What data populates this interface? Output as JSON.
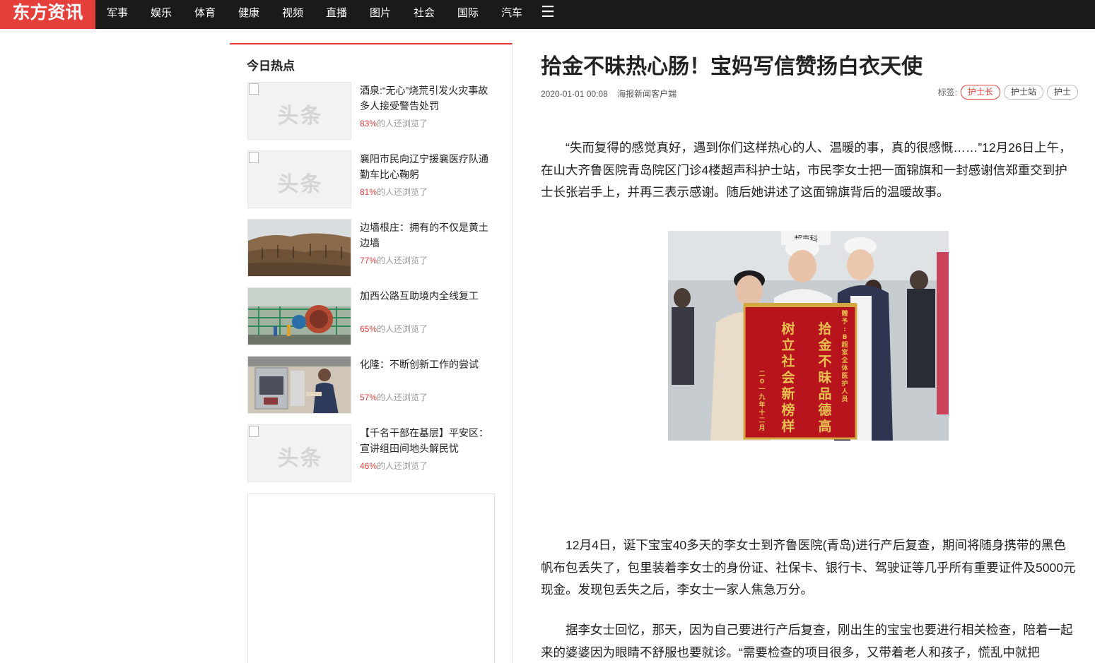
{
  "header": {
    "logo": "东方资讯",
    "nav": [
      "军事",
      "娱乐",
      "体育",
      "健康",
      "视频",
      "直播",
      "图片",
      "社会",
      "国际",
      "汽车"
    ],
    "more_icon": "menu-icon"
  },
  "sidebar": {
    "title": "今日热点",
    "placeholder_text": "头条",
    "stat_suffix": "的人还浏览了",
    "items": [
      {
        "title": "酒泉:“无心”烧荒引发火灾事故 多人接受警告处罚",
        "pct": "83%",
        "thumb": "placeholder"
      },
      {
        "title": "襄阳市民向辽宁援襄医疗队通勤车比心鞠躬",
        "pct": "81%",
        "thumb": "placeholder"
      },
      {
        "title": "边墙根庄：拥有的不仅是黄土边墙",
        "pct": "77%",
        "thumb": "dirt-field"
      },
      {
        "title": "加西公路互助境内全线复工",
        "pct": "65%",
        "thumb": "construction"
      },
      {
        "title": "化隆：不断创新工作的尝试",
        "pct": "57%",
        "thumb": "kitchen"
      },
      {
        "title": "【千名干部在基层】平安区：宣讲组田间地头解民忧",
        "pct": "46%",
        "thumb": "placeholder"
      }
    ]
  },
  "article": {
    "title": "拾金不昧热心肠！宝妈写信赞扬白衣天使",
    "date": "2020-01-01 00:08",
    "source": "海报新闻客户端",
    "tags_label": "标签:",
    "tags": [
      "护士长",
      "护士站",
      "护士"
    ],
    "paragraphs": [
      "“失而复得的感觉真好，遇到你们这样热心的人、温暖的事，真的很感慨……”12月26日上午，在山大齐鲁医院青岛院区门诊4楼超声科护士站，市民李女士把一面锦旗和一封感谢信郑重交到护士长张岩手上，并再三表示感谢。随后她讲述了这面锦旗背后的温暖故事。",
      "12月4日，诞下宝宝40多天的李女士到齐鲁医院(青岛)进行产后复查，期间将随身携带的黑色帆布包丢失了，包里装着李女士的身份证、社保卡、银行卡、驾驶证等几乎所有重要证件及5000元现金。发现包丢失之后，李女士一家人焦急万分。",
      "据李女士回忆，那天，因为自己要进行产后复查，刚出生的宝宝也要进行相关检查，陪着一起来的婆婆因为眼睛不舒服也要就诊。“需要检查的项目很多，又带着老人和孩子，慌乱中就把"
    ],
    "photo": {
      "sign": "超声科",
      "banner_lines": [
        "拾金不昧品德高",
        "树立社会新榜样"
      ],
      "banner_top": "赠予:B超室全体医护人员",
      "banner_bottom": "二0一九年十二月"
    }
  }
}
